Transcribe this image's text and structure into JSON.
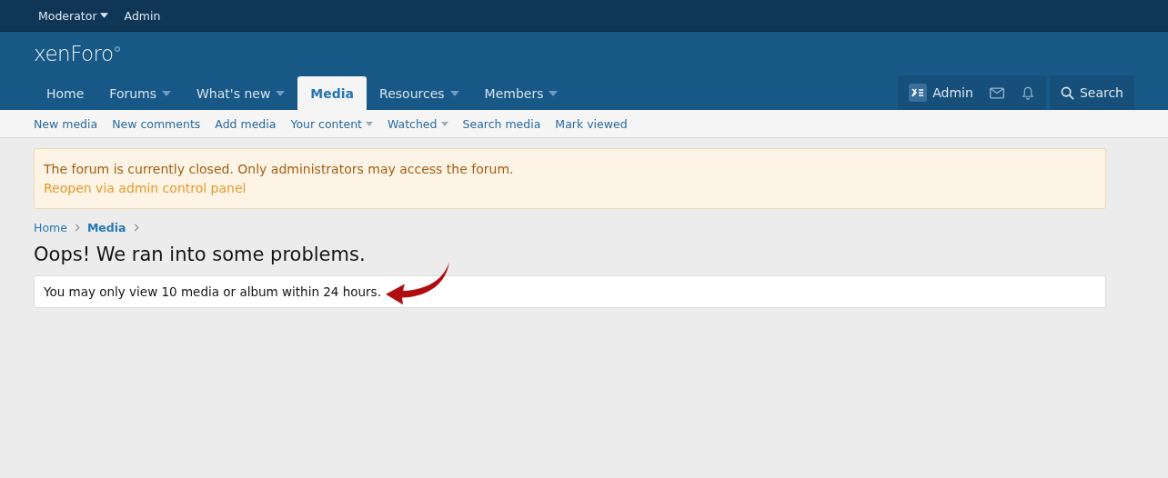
{
  "top_bar": {
    "items": [
      {
        "label": "Moderator",
        "has_dropdown": true
      },
      {
        "label": "Admin",
        "has_dropdown": false
      }
    ]
  },
  "header": {
    "logo": "xenForo"
  },
  "nav": {
    "tabs": [
      {
        "label": "Home",
        "has_dropdown": false,
        "selected": false
      },
      {
        "label": "Forums",
        "has_dropdown": true,
        "selected": false
      },
      {
        "label": "What's new",
        "has_dropdown": true,
        "selected": false
      },
      {
        "label": "Media",
        "has_dropdown": false,
        "selected": true
      },
      {
        "label": "Resources",
        "has_dropdown": true,
        "selected": false
      },
      {
        "label": "Members",
        "has_dropdown": true,
        "selected": false
      }
    ],
    "user": {
      "name": "Admin"
    },
    "search": {
      "label": "Search"
    }
  },
  "sub_nav": [
    {
      "label": "New media",
      "has_dropdown": false
    },
    {
      "label": "New comments",
      "has_dropdown": false
    },
    {
      "label": "Add media",
      "has_dropdown": false
    },
    {
      "label": "Your content",
      "has_dropdown": true
    },
    {
      "label": "Watched",
      "has_dropdown": true
    },
    {
      "label": "Search media",
      "has_dropdown": false
    },
    {
      "label": "Mark viewed",
      "has_dropdown": false
    }
  ],
  "notice": {
    "message": "The forum is currently closed. Only administrators may access the forum.",
    "link": "Reopen via admin control panel"
  },
  "breadcrumbs": [
    {
      "label": "Home",
      "current": false
    },
    {
      "label": "Media",
      "current": true
    }
  ],
  "page_title": "Oops! We ran into some problems.",
  "error": {
    "message": "You may only view 10 media or album within 24 hours.",
    "annotated": true
  }
}
